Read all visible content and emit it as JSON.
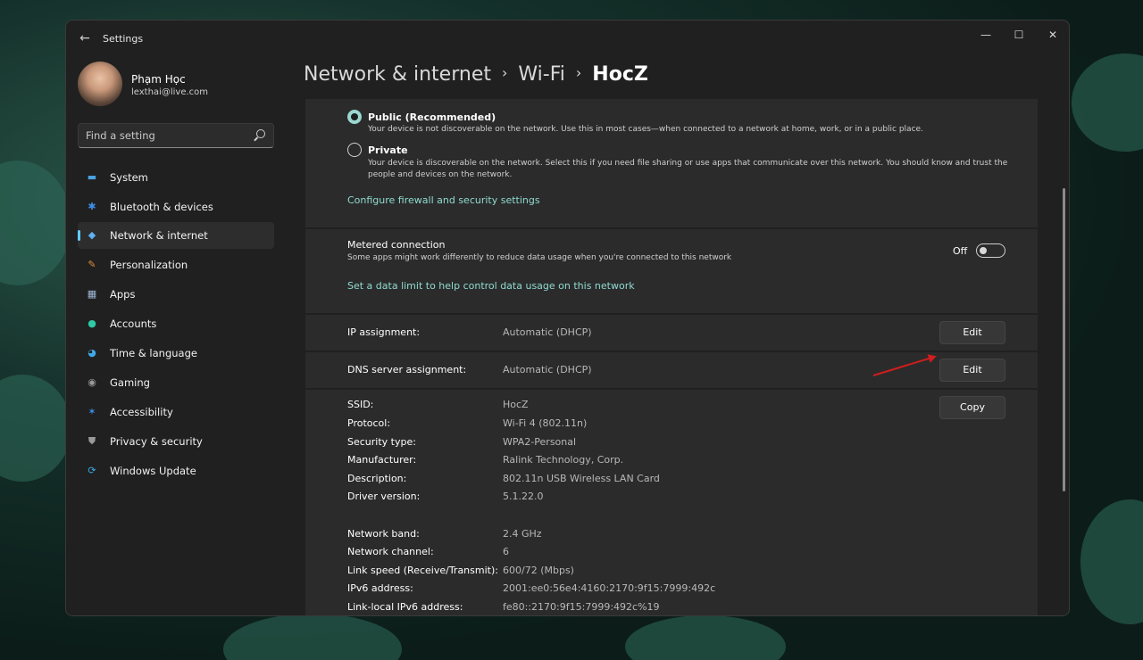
{
  "window": {
    "title": "Settings",
    "controls": {
      "minimize": "—",
      "maximize": "☐",
      "close": "✕"
    }
  },
  "user": {
    "name": "Phạm Học",
    "email": "lexthai@live.com"
  },
  "search": {
    "placeholder": "Find a setting"
  },
  "sidebar": {
    "items": [
      {
        "label": "System",
        "icon": "display-icon",
        "glyph": "▬",
        "color": "#4aa3e0"
      },
      {
        "label": "Bluetooth & devices",
        "icon": "bluetooth-icon",
        "glyph": "✱",
        "color": "#3c8fe6"
      },
      {
        "label": "Network & internet",
        "icon": "wifi-icon",
        "glyph": "◆",
        "color": "#5fb0f0",
        "active": true
      },
      {
        "label": "Personalization",
        "icon": "brush-icon",
        "glyph": "✎",
        "color": "#e08a3c"
      },
      {
        "label": "Apps",
        "icon": "apps-icon",
        "glyph": "▦",
        "color": "#9fb7d8"
      },
      {
        "label": "Accounts",
        "icon": "person-icon",
        "glyph": "●",
        "color": "#2fc9a5"
      },
      {
        "label": "Time & language",
        "icon": "globe-clock-icon",
        "glyph": "◕",
        "color": "#3da8e8"
      },
      {
        "label": "Gaming",
        "icon": "gamepad-icon",
        "glyph": "◉",
        "color": "#9a9a9a"
      },
      {
        "label": "Accessibility",
        "icon": "accessibility-icon",
        "glyph": "✶",
        "color": "#3c8fe6"
      },
      {
        "label": "Privacy & security",
        "icon": "shield-icon",
        "glyph": "⛊",
        "color": "#9a9a9a"
      },
      {
        "label": "Windows Update",
        "icon": "sync-icon",
        "glyph": "⟳",
        "color": "#3da8e8"
      }
    ]
  },
  "breadcrumb": {
    "part1": "Network & internet",
    "part2": "Wi-Fi",
    "part3": "HocZ",
    "separator": "›"
  },
  "profile": {
    "public_title": "Public (Recommended)",
    "public_desc": "Your device is not discoverable on the network. Use this in most cases—when connected to a network at home, work, or in a public place.",
    "private_title": "Private",
    "private_desc": "Your device is discoverable on the network. Select this if you need file sharing or use apps that communicate over this network. You should know and trust the people and devices on the network.",
    "firewall_link": "Configure firewall and security settings"
  },
  "metered": {
    "title": "Metered connection",
    "desc": "Some apps might work differently to reduce data usage when you're connected to this network",
    "state": "Off",
    "link": "Set a data limit to help control data usage on this network"
  },
  "ip": {
    "label": "IP assignment:",
    "value": "Automatic (DHCP)",
    "button": "Edit"
  },
  "dns": {
    "label": "DNS server assignment:",
    "value": "Automatic (DHCP)",
    "button": "Edit"
  },
  "properties": {
    "copy_button": "Copy",
    "rows": [
      {
        "label": "SSID:",
        "value": "HocZ"
      },
      {
        "label": "Protocol:",
        "value": "Wi-Fi 4 (802.11n)"
      },
      {
        "label": "Security type:",
        "value": "WPA2-Personal"
      },
      {
        "label": "Manufacturer:",
        "value": "Ralink Technology, Corp."
      },
      {
        "label": "Description:",
        "value": "802.11n USB Wireless LAN Card"
      },
      {
        "label": "Driver version:",
        "value": "5.1.22.0"
      },
      {
        "label": "Network band:",
        "value": "2.4 GHz"
      },
      {
        "label": "Network channel:",
        "value": "6"
      },
      {
        "label": "Link speed (Receive/Transmit):",
        "value": "600/72 (Mbps)"
      },
      {
        "label": "IPv6 address:",
        "value": "2001:ee0:56e4:4160:2170:9f15:7999:492c"
      },
      {
        "label": "Link-local IPv6 address:",
        "value": "fe80::2170:9f15:7999:492c%19"
      }
    ]
  },
  "colors": {
    "accent": "#60cdff",
    "link": "#8fdbd0",
    "annotation_arrow": "#d11d1d"
  }
}
